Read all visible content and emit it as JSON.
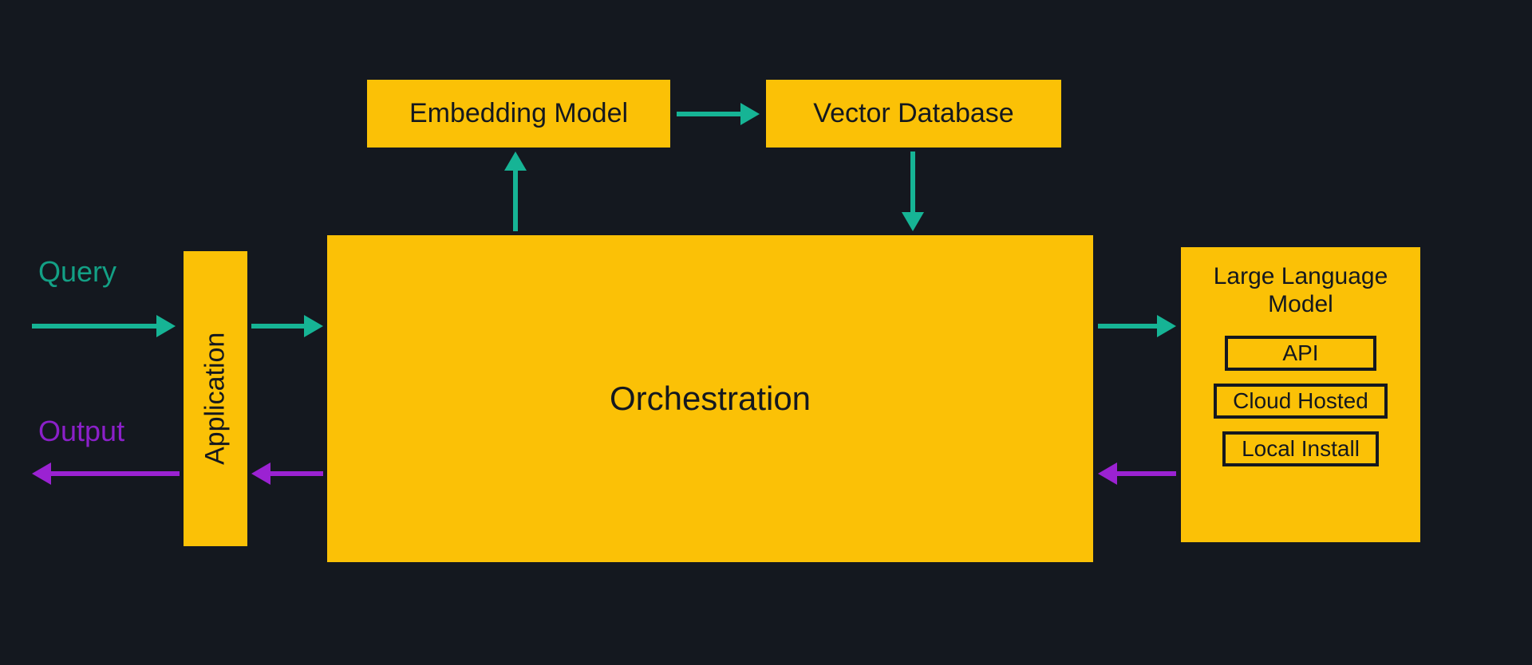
{
  "labels": {
    "query": "Query",
    "output": "Output"
  },
  "nodes": {
    "application": "Application",
    "orchestration": "Orchestration",
    "embedding_model": "Embedding Model",
    "vector_database": "Vector Database",
    "llm_title": "Large Language Model",
    "llm_options": [
      "API",
      "Cloud Hosted",
      "Local Install"
    ]
  },
  "colors": {
    "box_fill": "#fbc106",
    "box_text": "#14181f",
    "bg": "#14181f",
    "flow_forward": "#16b495",
    "flow_return": "#9b22d2"
  },
  "edges": [
    {
      "from": "external-query",
      "to": "application",
      "color": "green",
      "dir": "right"
    },
    {
      "from": "application",
      "to": "orchestration",
      "color": "green",
      "dir": "right"
    },
    {
      "from": "orchestration",
      "to": "embedding-model",
      "color": "green",
      "dir": "up"
    },
    {
      "from": "embedding-model",
      "to": "vector-database",
      "color": "green",
      "dir": "right"
    },
    {
      "from": "vector-database",
      "to": "orchestration",
      "color": "green",
      "dir": "down"
    },
    {
      "from": "orchestration",
      "to": "llm",
      "color": "green",
      "dir": "right"
    },
    {
      "from": "llm",
      "to": "orchestration",
      "color": "purple",
      "dir": "left"
    },
    {
      "from": "orchestration",
      "to": "application",
      "color": "purple",
      "dir": "left"
    },
    {
      "from": "application",
      "to": "external-output",
      "color": "purple",
      "dir": "left"
    }
  ]
}
